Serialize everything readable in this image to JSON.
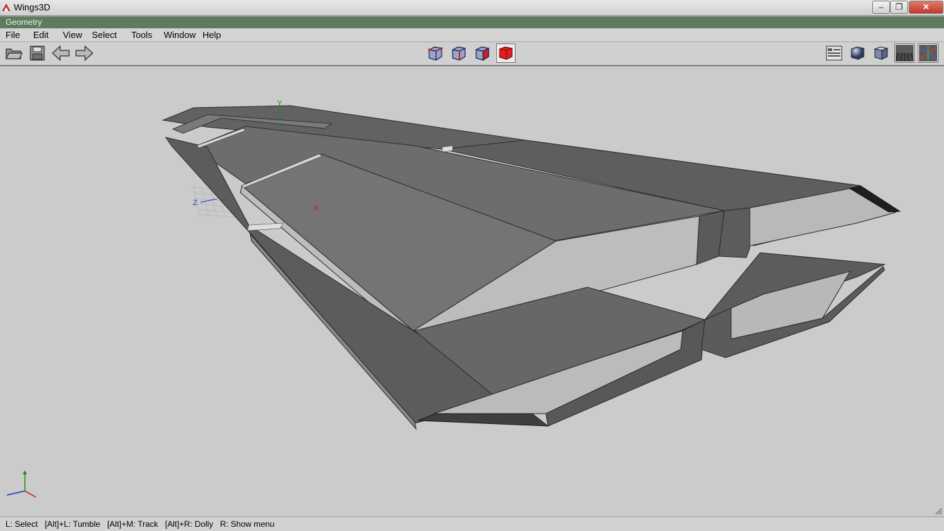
{
  "window": {
    "title": "Wings3D"
  },
  "geometry_bar": {
    "title": "Geometry"
  },
  "menu": [
    {
      "label": "File"
    },
    {
      "label": "Edit"
    },
    {
      "label": "View"
    },
    {
      "label": "Select"
    },
    {
      "label": "Tools"
    },
    {
      "label": "Window"
    },
    {
      "label": "Help"
    }
  ],
  "toolbar": {
    "left_icons": [
      "folder-open-icon",
      "save-icon",
      "undo-arrow-icon",
      "redo-arrow-icon"
    ],
    "selection_modes": [
      "vertex-mode-icon",
      "edge-mode-icon",
      "face-mode-icon",
      "body-mode-icon"
    ],
    "active_selection_mode": "body-mode-icon",
    "right_icons": [
      "info-panel-icon",
      "smooth-shading-icon",
      "flat-shading-icon",
      "groundplane-icon",
      "axes-icon"
    ]
  },
  "viewport": {
    "axis_labels": {
      "y": "Y",
      "z": "Z",
      "x": "X"
    },
    "colors": {
      "background": "#cbcbcb",
      "y_axis": "#1a8f1a",
      "x_axis": "#c81a1a",
      "z_axis": "#1a3ac8"
    }
  },
  "status": {
    "text": "L: Select   [Alt]+L: Tumble   [Alt]+M: Track   [Alt]+R: Dolly   R: Show menu"
  }
}
